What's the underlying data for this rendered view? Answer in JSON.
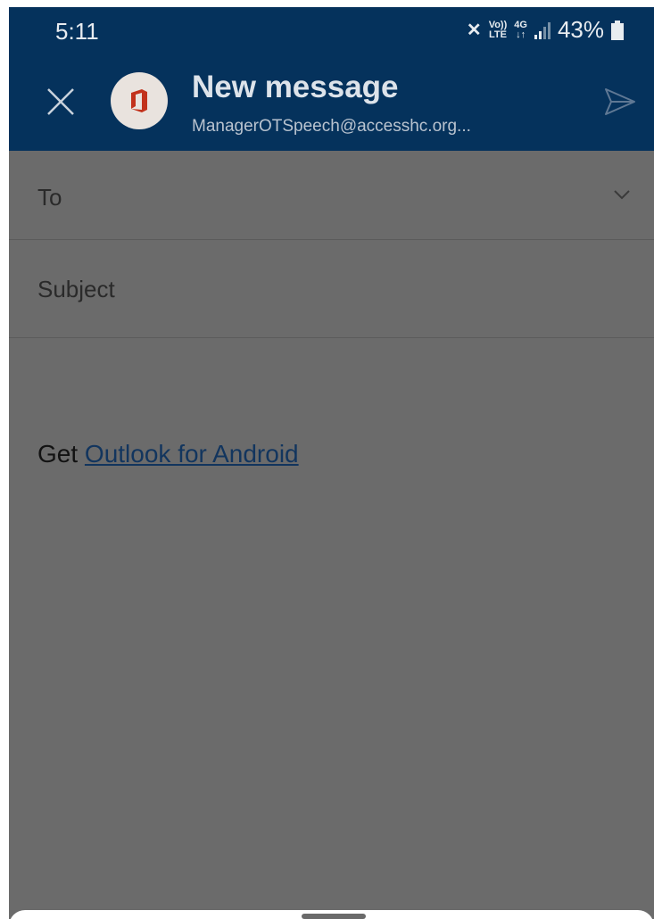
{
  "status_bar": {
    "time": "5:11",
    "volte_top": "Vo))",
    "volte_bottom": "LTE",
    "network_top": "4G",
    "network_bottom": "↓↑",
    "battery_percent": "43%"
  },
  "header": {
    "title": "New message",
    "account": "ManagerOTSpeech@accesshc.org...",
    "colors": {
      "background": "#05325c",
      "avatar_logo": "#c2321c"
    }
  },
  "compose": {
    "to_label": "To",
    "subject_label": "Subject",
    "signature_prefix": "Get ",
    "signature_link": "Outlook for Android"
  },
  "icons": {
    "close": "close-icon",
    "account": "office-logo-icon",
    "send": "send-icon",
    "expand": "chevron-down-icon"
  }
}
